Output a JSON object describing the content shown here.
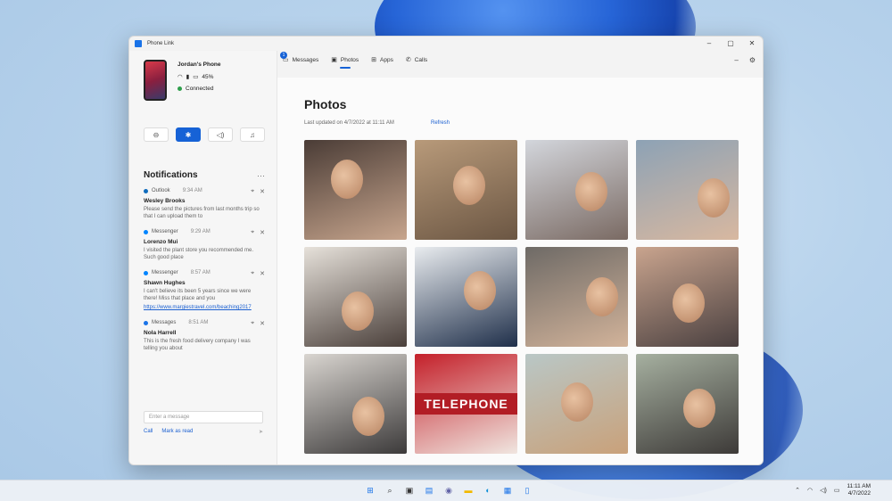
{
  "window": {
    "title": "Phone Link"
  },
  "device": {
    "name": "Jordan's Phone",
    "battery": "45%",
    "status": "Connected"
  },
  "quick_actions": [
    {
      "name": "do-not-disturb",
      "icon": "minus-circle-icon",
      "glyph": "⊖"
    },
    {
      "name": "bluetooth",
      "icon": "bluetooth-icon",
      "glyph": "✱",
      "active": true
    },
    {
      "name": "volume",
      "icon": "speaker-icon",
      "glyph": "◁)"
    },
    {
      "name": "music",
      "icon": "music-note-icon",
      "glyph": "♫"
    }
  ],
  "notifications": {
    "title": "Notifications",
    "more": "···",
    "items": [
      {
        "app": "Outlook",
        "time": "9:34 AM",
        "sender": "Wesley Brooks",
        "body": "Please send the pictures from last months trip so that I can upload them to",
        "color": "#0f6cbd"
      },
      {
        "app": "Messenger",
        "time": "9:29 AM",
        "sender": "Lorenzo Mui",
        "body": "I visited the plant store you recommended me. Such good place",
        "color": "#0084ff"
      },
      {
        "app": "Messenger",
        "time": "8:57 AM",
        "sender": "Shawn Hughes",
        "body": "I can't believe its been 5 years since we were there! Miss that place and you",
        "link": "https://www.margiestravel.com/beaching2017",
        "color": "#0084ff"
      },
      {
        "app": "Messages",
        "time": "8:51 AM",
        "sender": "Nola Harrell",
        "body": "This is the fresh food delivery company I was telling you about",
        "color": "#1a73e8"
      }
    ]
  },
  "message_input": {
    "placeholder": "Enter a message"
  },
  "message_actions": {
    "call": "Call",
    "mark_read": "Mark as read",
    "send": "➤"
  },
  "tabs": [
    {
      "label": "Messages",
      "icon": "chat-icon",
      "glyph": "▭",
      "badge": "1"
    },
    {
      "label": "Photos",
      "icon": "photo-icon",
      "glyph": "▣",
      "active": true
    },
    {
      "label": "Apps",
      "icon": "apps-icon",
      "glyph": "⊞"
    },
    {
      "label": "Calls",
      "icon": "phone-icon",
      "glyph": "✆"
    }
  ],
  "main": {
    "title": "Photos",
    "updated": "Last updated on 4/7/2022 at 11:11 AM",
    "refresh": "Refresh"
  },
  "photos": [
    {
      "bg1": "#4a3c36",
      "bg2": "#c7a58d"
    },
    {
      "bg1": "#b89a7a",
      "bg2": "#6b5643"
    },
    {
      "bg1": "#d3d6dc",
      "bg2": "#7a6a63"
    },
    {
      "bg1": "#8da2b5",
      "bg2": "#d8b8a0"
    },
    {
      "bg1": "#e6e1da",
      "bg2": "#4a3f3a"
    },
    {
      "bg1": "#e9ecef",
      "bg2": "#1f2f4a"
    },
    {
      "bg1": "#6e6a66",
      "bg2": "#d2b39a"
    },
    {
      "bg1": "#c9a48e",
      "bg2": "#4a4040"
    },
    {
      "bg1": "#d9d5d0",
      "bg2": "#3c3a3a"
    },
    {
      "bg1": "#c4202a",
      "bg2": "#f0e6e0",
      "text": "TELEPHONE"
    },
    {
      "bg1": "#b9c7c6",
      "bg2": "#c9a17a"
    },
    {
      "bg1": "#a6b0a0",
      "bg2": "#3d3a38"
    }
  ],
  "taskbar": {
    "icons": [
      {
        "name": "start",
        "glyph": "⊞",
        "color": "#1a73e8"
      },
      {
        "name": "search",
        "glyph": "⌕",
        "color": "#333"
      },
      {
        "name": "task-view",
        "glyph": "▣",
        "color": "#333"
      },
      {
        "name": "widgets",
        "glyph": "▤",
        "color": "#1a73e8"
      },
      {
        "name": "chat",
        "glyph": "◉",
        "color": "#6264a7"
      },
      {
        "name": "file-explorer",
        "glyph": "▬",
        "color": "#f2b900"
      },
      {
        "name": "edge",
        "glyph": "◐",
        "color": "#0f8fd8"
      },
      {
        "name": "store",
        "glyph": "▦",
        "color": "#1a73e8"
      },
      {
        "name": "phone-link",
        "glyph": "▯",
        "color": "#1a73e8"
      }
    ],
    "time": "11:11 AM",
    "date": "4/7/2022"
  }
}
